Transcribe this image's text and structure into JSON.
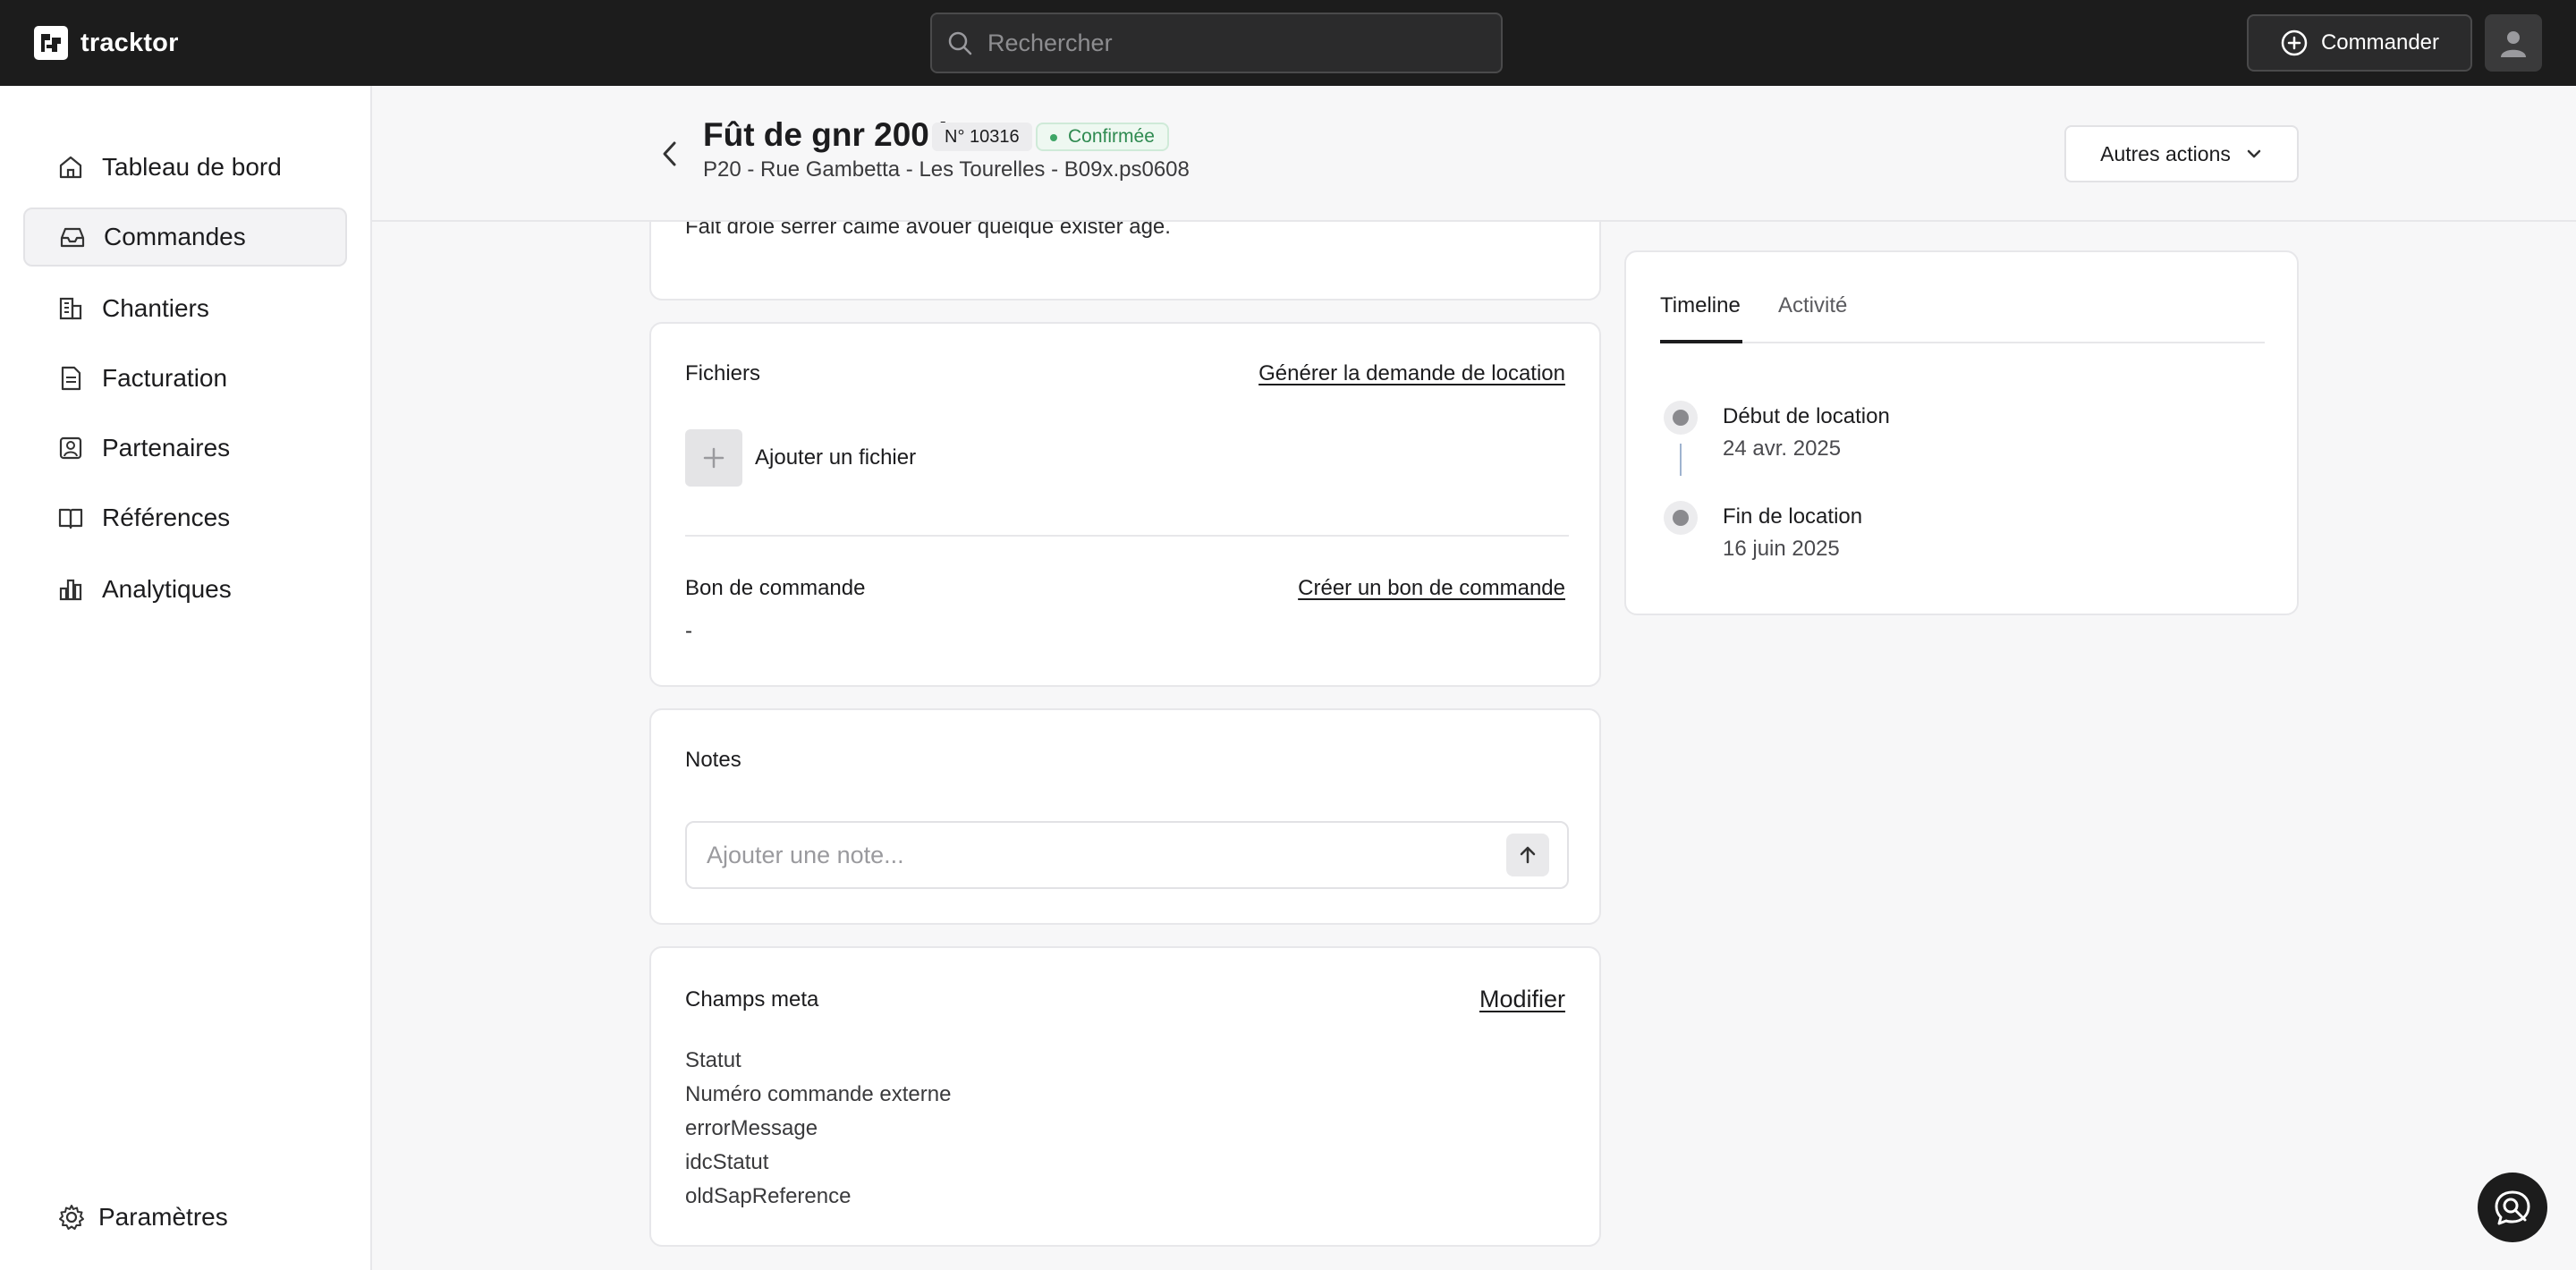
{
  "app": {
    "name": "tracktor"
  },
  "search": {
    "placeholder": "Rechercher"
  },
  "topbar": {
    "order_button_label": "Commander"
  },
  "sidebar": {
    "items": [
      {
        "label": "Tableau de bord",
        "icon": "home-icon"
      },
      {
        "label": "Commandes",
        "icon": "inbox-icon",
        "active": true
      },
      {
        "label": "Chantiers",
        "icon": "building-icon"
      },
      {
        "label": "Facturation",
        "icon": "invoice-icon"
      },
      {
        "label": "Partenaires",
        "icon": "contact-icon"
      },
      {
        "label": "Références",
        "icon": "book-icon"
      },
      {
        "label": "Analytiques",
        "icon": "bar-chart-icon"
      }
    ],
    "settings_label": "Paramètres"
  },
  "order": {
    "title": "Fût de gnr 200 l",
    "number": "N° 10316",
    "status": "Confirmée",
    "subtitle": "P20 - Rue Gambetta - Les Tourelles - B09x.ps0608",
    "other_actions_label": "Autres actions",
    "description": "Fait drôle serrer calme avouer quelque exister âge."
  },
  "files": {
    "heading": "Fichiers",
    "generate_link": "Générer la demande de location",
    "add_file_label": "Ajouter un fichier",
    "purchase_order_heading": "Bon de commande",
    "create_po_link": "Créer un bon de commande",
    "purchase_order_value": "-"
  },
  "notes": {
    "heading": "Notes",
    "placeholder": "Ajouter une note..."
  },
  "meta": {
    "heading": "Champs meta",
    "edit_link": "Modifier",
    "fields": [
      "Statut",
      "Numéro commande externe",
      "errorMessage",
      "idcStatut",
      "oldSapReference"
    ]
  },
  "timeline": {
    "tabs": [
      "Timeline",
      "Activité"
    ],
    "events": [
      {
        "title": "Début de location",
        "date": "24 avr. 2025"
      },
      {
        "title": "Fin de location",
        "date": "16 juin 2025"
      }
    ]
  },
  "colors": {
    "topbar_bg": "#1c1c1c",
    "status_green": "#2e8a50",
    "timeline_line": "#9fb3cf"
  }
}
